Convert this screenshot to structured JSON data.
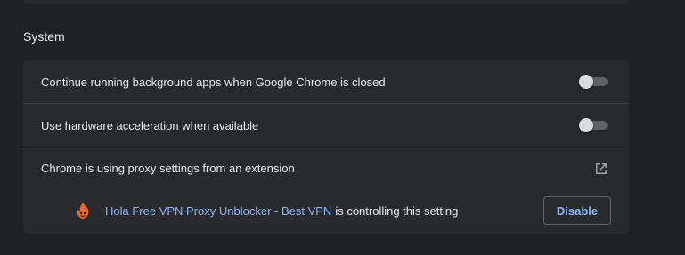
{
  "section": {
    "title": "System"
  },
  "rows": [
    {
      "label": "Continue running background apps when Google Chrome is closed",
      "toggle_on": false
    },
    {
      "label": "Use hardware acceleration when available",
      "toggle_on": false
    },
    {
      "label": "Chrome is using proxy settings from an extension",
      "icon": "open-in-new-icon"
    }
  ],
  "extension": {
    "icon": "hola-flame-icon",
    "name": "Hola Free VPN Proxy Unblocker - Best VPN",
    "suffix": "is controlling this setting",
    "button_label": "Disable"
  },
  "colors": {
    "background": "#202124",
    "card": "#292a2d",
    "accent": "#8ab4f8",
    "text": "#e8eaed",
    "hola_orange": "#f26522"
  }
}
